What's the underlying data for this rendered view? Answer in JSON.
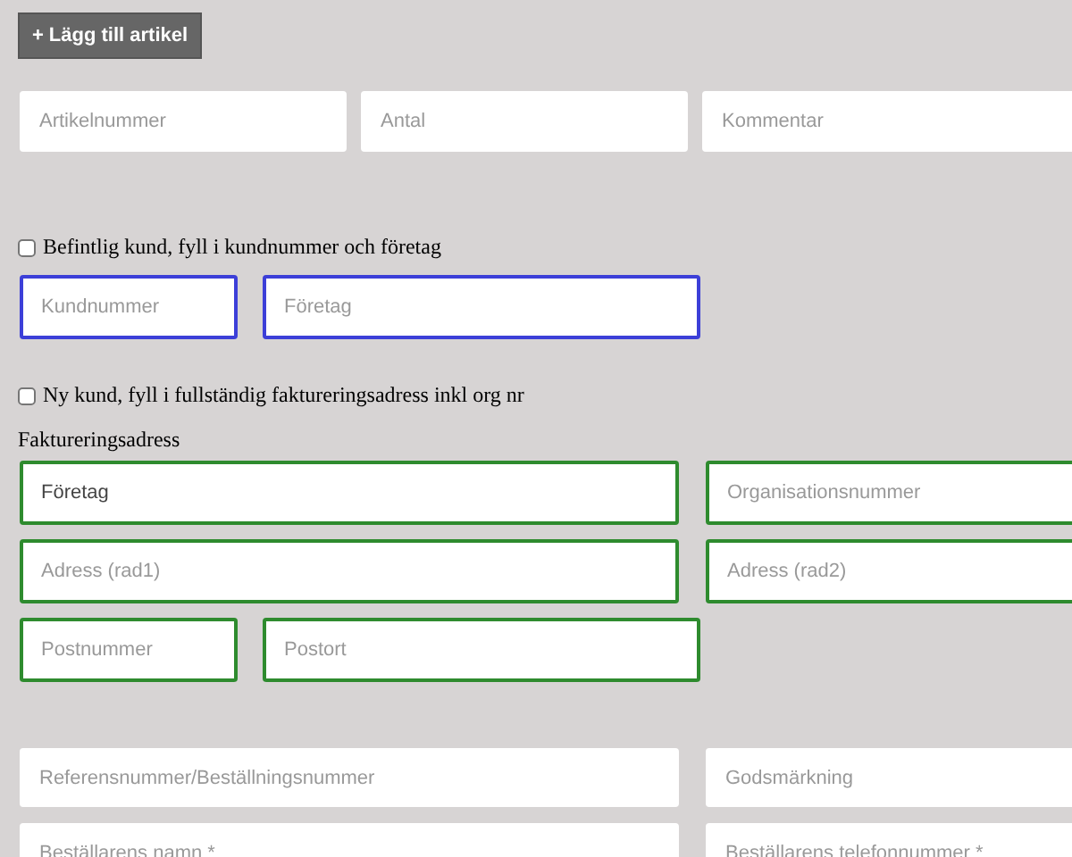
{
  "add_button": {
    "label": "+ Lägg till artikel"
  },
  "article_fields": [
    {
      "placeholder": "Artikelnummer",
      "kind": "plain"
    },
    {
      "placeholder": "Antal",
      "kind": "plain"
    },
    {
      "placeholder": "Kommentar",
      "kind": "plain"
    }
  ],
  "existing_customer": {
    "label": "Befintlig kund, fyll i kundnummer och företag",
    "checked": false,
    "fields": [
      {
        "placeholder": "Kundnummer",
        "kind": "focused"
      },
      {
        "placeholder": "Företag",
        "kind": "focused"
      }
    ]
  },
  "new_customer": {
    "label": "Ny kund, fyll i fullständig faktureringsadress inkl org nr",
    "checked": false
  },
  "billing": {
    "heading": "Faktureringsadress",
    "rows": [
      [
        {
          "value": "Företag",
          "kind": "valid"
        },
        {
          "placeholder": "Organisationsnummer",
          "kind": "valid"
        }
      ],
      [
        {
          "placeholder": "Adress (rad1)",
          "kind": "valid"
        },
        {
          "placeholder": "Adress (rad2)",
          "kind": "valid"
        }
      ],
      [
        {
          "placeholder": "Postnummer",
          "kind": "valid"
        },
        {
          "placeholder": "Postort",
          "kind": "valid"
        }
      ]
    ]
  },
  "order_rows": [
    [
      {
        "placeholder": "Referensnummer/Beställningsnummer",
        "kind": "plain"
      },
      {
        "placeholder": "Godsmärkning",
        "kind": "plain"
      }
    ],
    [
      {
        "placeholder": "Beställarens namn *",
        "kind": "plain"
      },
      {
        "placeholder": "Beställarens telefonnummer *",
        "kind": "plain"
      }
    ]
  ]
}
